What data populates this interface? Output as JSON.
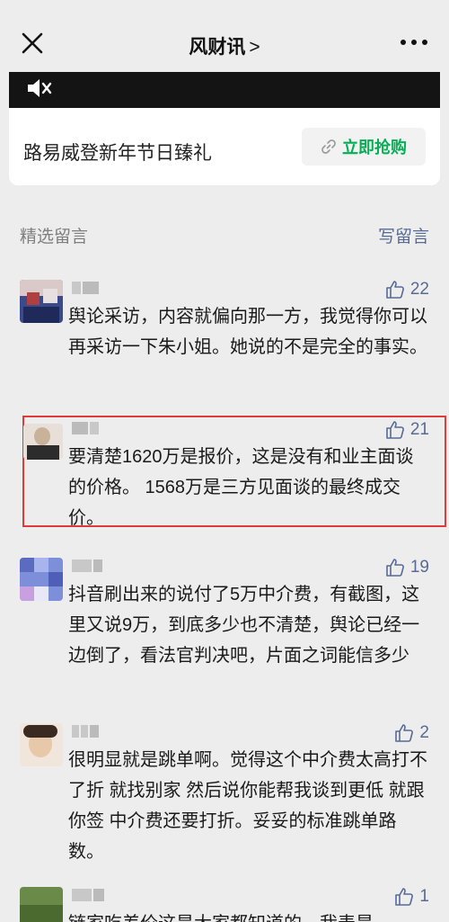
{
  "header": {
    "title": "风财讯",
    "title_chevron": ">",
    "close_icon": "close-icon",
    "more_icon": "more-icon"
  },
  "product_card": {
    "name": "路易威登新年节日臻礼",
    "buy_label": "立即抢购",
    "mute_icon": "mute-icon",
    "accent_color": "#06ae56"
  },
  "comments_section": {
    "label": "精选留言",
    "write_label": "写留言"
  },
  "comments": [
    {
      "likes": "22",
      "text": "舆论采访，内容就偏向那一方，我觉得你可以再采访一下朱小姐。她说的不是完全的事实。"
    },
    {
      "likes": "21",
      "text": "要清楚1620万是报价，这是没有和业主面谈的价格。 1568万是三方见面谈的最终成交价。"
    },
    {
      "likes": "19",
      "text": "抖音刷出来的说付了5万中介费，有截图，这里又说9万，到底多少也不清楚，舆论已经一边倒了，看法官判决吧，片面之词能信多少"
    },
    {
      "likes": "2",
      "text": "很明显就是跳单啊。觉得这个中介费太高打不了折 就找别家 然后说你能帮我谈到更低 就跟你签 中介费还要打折。妥妥的标准跳单路数。"
    },
    {
      "likes": "1",
      "text": "链家吃差价这是大家都知道的，我表是"
    }
  ]
}
